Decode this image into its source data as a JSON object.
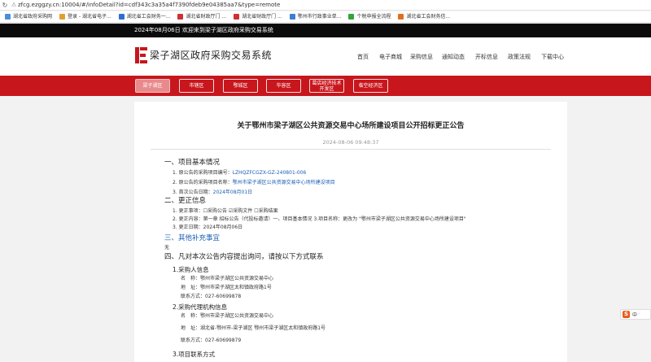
{
  "browser": {
    "url": "zfcg.ezggzy.cn:10004/#/infoDetail?id=cdf343c3a35a4f7390fdeb9e04385aa7&type=remote",
    "bookmarks": [
      {
        "label": "湖北省政府采购网",
        "color": "#4a8fd8"
      },
      {
        "label": "登录 - 湖北省电子...",
        "color": "#e0a030"
      },
      {
        "label": "湖北省工会财务一...",
        "color": "#2d6fd0"
      },
      {
        "label": "湖北省财政厅门 ...",
        "color": "#d03030"
      },
      {
        "label": "湖北省财政厅门 ...",
        "color": "#d03030"
      },
      {
        "label": "鄂州市行政事业单...",
        "color": "#3a7fd0"
      },
      {
        "label": "个税申报全流程",
        "color": "#33a33a"
      },
      {
        "label": "湖北省工会财务信...",
        "color": "#e07020"
      }
    ]
  },
  "site": {
    "welcome": "2024年08月06日 欢迎来到梁子湖区政府采购交易系统",
    "title": "梁子湖区政府采购交易系统",
    "nav": [
      "首页",
      "电子商城",
      "采购信息",
      "通知动态",
      "开标信息",
      "政策法规",
      "下载中心"
    ],
    "districts": [
      "梁子湖区",
      "市辖区",
      "鄂城区",
      "华容区",
      "葛店经济技术开发区",
      "临空经济区"
    ],
    "active_district": 0
  },
  "article": {
    "title": "关于鄂州市梁子湖区公共资源交易中心场所建设项目公开招标更正公告",
    "date": "2024-08-06 09:48:37",
    "s1": "一、项目基本情况",
    "s1_items": [
      {
        "label": "1. 原公告的采购项目编号：",
        "value": "LZHQZFCGZX-GZ-240801-006"
      },
      {
        "label": "2. 原公告的采购项目名称：",
        "value": "鄂州市梁子湖区公共资源交易中心场所建设项目"
      },
      {
        "label": "3. 首次公告日期：",
        "value": "2024年08月01日"
      }
    ],
    "s2": "二、更正信息",
    "s2_items": [
      "1. 更正事项：☐采购公告 ☑采购文件 ☐采购结果",
      "2. 更正内容：第一章 招标公告（代投标邀请）一、项目基本情况 3.项目名称：更改为 \"鄂州市梁子湖区公共资源交易中心场所建设项目\"",
      "3. 更正日期：2024年08月06日"
    ],
    "s3": "三、其他补充事宜",
    "s3_body": "无",
    "s4": "四、凡对本次公告内容提出询问，请按以下方式联系",
    "c1_title": "1.采购人信息",
    "c1_lines": [
      "名　称：鄂州市梁子湖区公共资源交易中心",
      "地　址：鄂州市梁子湖区太和镇政府路1号",
      "联系方式：027-60699878"
    ],
    "c2_title": "2.采购代理机构信息",
    "c2_lines": [
      "名　称：鄂州市梁子湖区公共资源交易中心",
      "地　址：湖北省-鄂州市-梁子湖区 鄂州市梁子湖区太和镇政府路1号",
      "联系方式：027-60699879"
    ],
    "c3_title": "3.项目联系方式"
  },
  "ime": {
    "logo": "S",
    "label": "中"
  }
}
